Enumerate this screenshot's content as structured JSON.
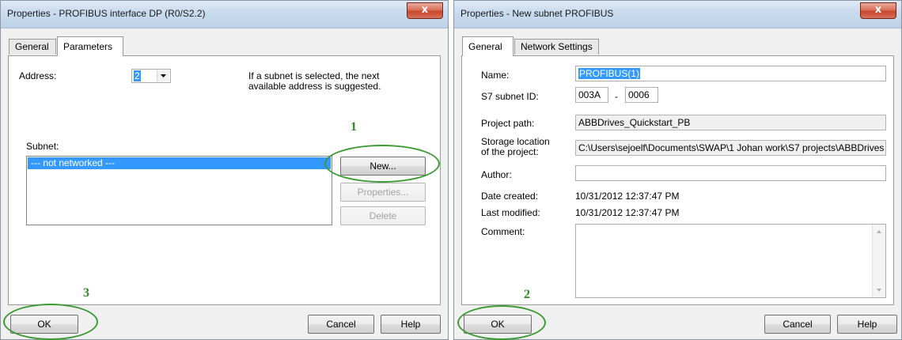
{
  "dialog1": {
    "title": "Properties - PROFIBUS interface  DP (R0/S2.2)",
    "close_glyph": "x",
    "tabs": [
      "General",
      "Parameters"
    ],
    "address_label": "Address:",
    "address_value": "2",
    "hint_line1": "If a subnet is selected, the next",
    "hint_line2": "available address is suggested.",
    "subnet_label": "Subnet:",
    "subnet_item": "--- not networked ---",
    "new_button": "New...",
    "properties_button": "Properties...",
    "delete_button": "Delete",
    "ok_button": "OK",
    "cancel_button": "Cancel",
    "help_button": "Help"
  },
  "dialog2": {
    "title": "Properties -  New subnet PROFIBUS",
    "close_glyph": "x",
    "tabs": [
      "General",
      "Network Settings"
    ],
    "name_label": "Name:",
    "name_value": "PROFIBUS(1)",
    "subnet_id_label": "S7 subnet ID:",
    "subnet_id_1": "003A",
    "subnet_id_sep": "-",
    "subnet_id_2": "0006",
    "project_path_label": "Project path:",
    "project_path_value": "ABBDrives_Quickstart_PB",
    "storage_label_line1": "Storage location",
    "storage_label_line2": "of the project:",
    "storage_value": "C:\\Users\\sejoelf\\Documents\\SWAP\\1 Johan work\\S7 projects\\ABBDrives",
    "author_label": "Author:",
    "author_value": "",
    "date_created_label": "Date created:",
    "date_created_value": "10/31/2012 12:37:47 PM",
    "last_modified_label": "Last modified:",
    "last_modified_value": "10/31/2012 12:37:47 PM",
    "comment_label": "Comment:",
    "ok_button": "OK",
    "cancel_button": "Cancel",
    "help_button": "Help"
  },
  "annotations": {
    "step1": "1",
    "step2": "2",
    "step3": "3"
  },
  "colors": {
    "annotation_green": "#3d9a35",
    "selection_blue": "#3399ff"
  }
}
